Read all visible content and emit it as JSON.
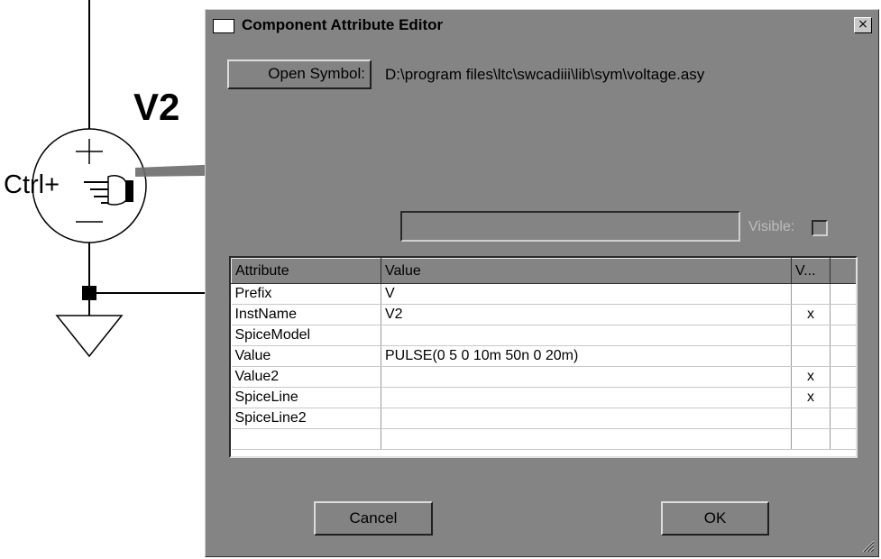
{
  "schematic": {
    "component_name": "V2",
    "hint_text": "Ctrl+"
  },
  "dialog": {
    "title": "Component Attribute Editor",
    "close_glyph": "×",
    "open_symbol_label": "Open Symbol:",
    "symbol_path": "D:\\program files\\ltc\\swcadiii\\lib\\sym\\voltage.asy",
    "value_field": "",
    "visible_label": "Visible:",
    "visible_checked": false,
    "table": {
      "headers": [
        "Attribute",
        "Value",
        "V..."
      ],
      "rows": [
        {
          "attribute": "Prefix",
          "value": "V",
          "visible": ""
        },
        {
          "attribute": "InstName",
          "value": "V2",
          "visible": "x"
        },
        {
          "attribute": "SpiceModel",
          "value": "",
          "visible": ""
        },
        {
          "attribute": "Value",
          "value": "PULSE(0 5 0 10m 50n 0 20m)",
          "visible": ""
        },
        {
          "attribute": "Value2",
          "value": "",
          "visible": "x"
        },
        {
          "attribute": "SpiceLine",
          "value": "",
          "visible": "x"
        },
        {
          "attribute": "SpiceLine2",
          "value": "",
          "visible": ""
        },
        {
          "attribute": "",
          "value": "",
          "visible": ""
        }
      ]
    },
    "cancel_label": "Cancel",
    "ok_label": "OK"
  },
  "icons": {
    "pointer": "hand-pointer-icon",
    "arrow": "right-arrow-icon",
    "source": "voltage-source-icon",
    "ground": "ground-icon"
  }
}
